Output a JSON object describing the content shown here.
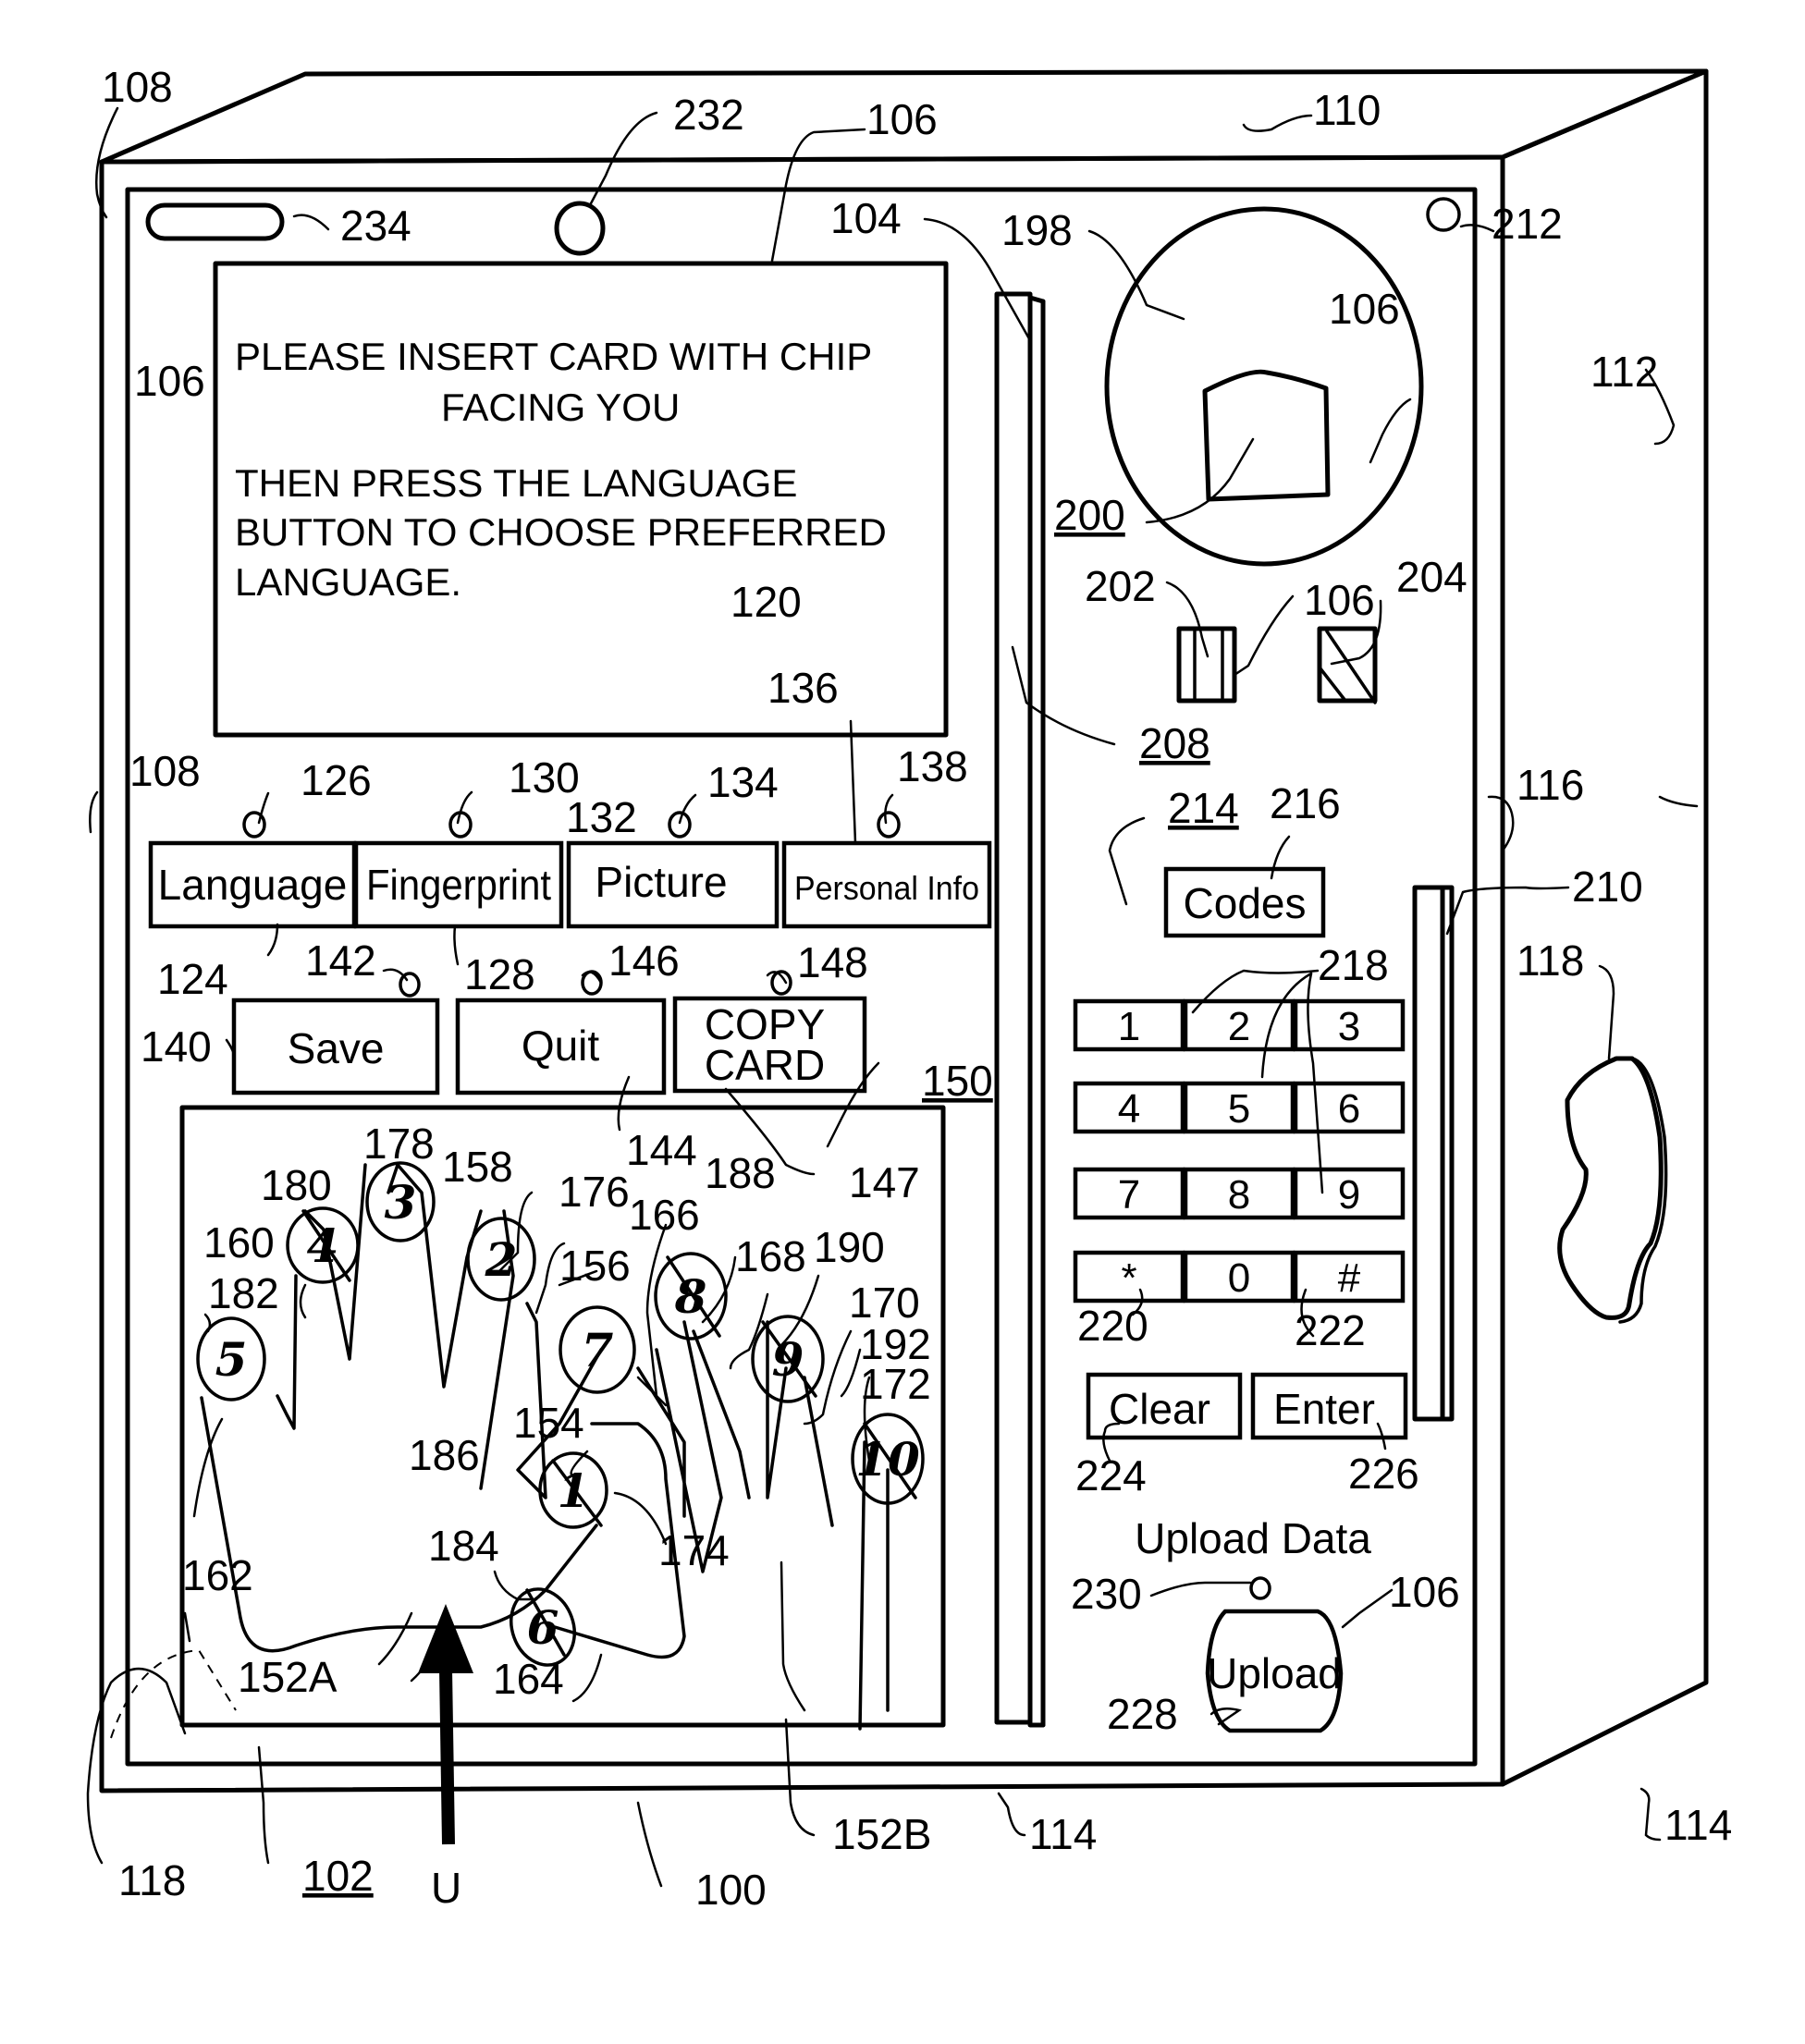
{
  "figure": {
    "type": "patent-drawing",
    "subject": "self-service card kiosk with touchscreen, keypad and hand/fingerprint scanner"
  },
  "screen": {
    "line1": "PLEASE INSERT CARD WITH CHIP",
    "line2": "FACING YOU",
    "line3": "THEN PRESS THE LANGUAGE",
    "line4": "BUTTON TO CHOOSE PREFERRED",
    "line5": "LANGUAGE."
  },
  "function_buttons": {
    "row1": [
      {
        "label": "Language",
        "ref": "124",
        "indicator_ref": "126"
      },
      {
        "label": "Fingerprint",
        "ref": "128",
        "indicator_ref": "130"
      },
      {
        "label": "Picture",
        "ref": "132",
        "indicator_ref": "134"
      },
      {
        "label": "Personal Info",
        "ref": "136",
        "indicator_ref": "138"
      }
    ],
    "row2": [
      {
        "label": "Save",
        "ref": "140",
        "indicator_ref": "142"
      },
      {
        "label": "Quit",
        "ref": "144",
        "indicator_ref": "146"
      },
      {
        "label": "COPY",
        "label2": "CARD",
        "ref": "147",
        "indicator_ref": "148"
      }
    ]
  },
  "hand_scanner": {
    "ref": "150",
    "finger_numbers": [
      "1",
      "2",
      "3",
      "4",
      "5",
      "6",
      "7",
      "8",
      "9",
      "10"
    ],
    "refs": {
      "r152A": "152A",
      "r152B": "152B",
      "r154": "154",
      "r156": "156",
      "r158": "158",
      "r160": "160",
      "r162": "162",
      "r164": "164",
      "r166": "166",
      "r168": "168",
      "r170": "170",
      "r172": "172",
      "r174": "174",
      "r176": "176",
      "r178": "178",
      "r180": "180",
      "r182": "182",
      "r184": "184",
      "r186": "186",
      "r188": "188",
      "r190": "190",
      "r192": "192"
    }
  },
  "right_panel": {
    "codes_button": "Codes",
    "keypad": [
      "1",
      "2",
      "3",
      "4",
      "5",
      "6",
      "7",
      "8",
      "9",
      "*",
      "0",
      "#"
    ],
    "clear_button": "Clear",
    "enter_button": "Enter",
    "upload_heading": "Upload Data",
    "upload_button": "Upload"
  },
  "reference_numerals": {
    "r100": "100",
    "r102": "102",
    "r104": "104",
    "r106": "106",
    "r108": "108",
    "r110": "110",
    "r112": "112",
    "r114": "114",
    "r116": "116",
    "r118": "118",
    "r120": "120",
    "r198": "198",
    "r200": "200",
    "r202": "202",
    "r204": "204",
    "r208": "208",
    "r210": "210",
    "r212": "212",
    "r214": "214",
    "r216": "216",
    "r218": "218",
    "r220": "220",
    "r222": "222",
    "r224": "224",
    "r226": "226",
    "r228": "228",
    "r230": "230",
    "r232": "232",
    "r234": "234",
    "user": "U"
  }
}
